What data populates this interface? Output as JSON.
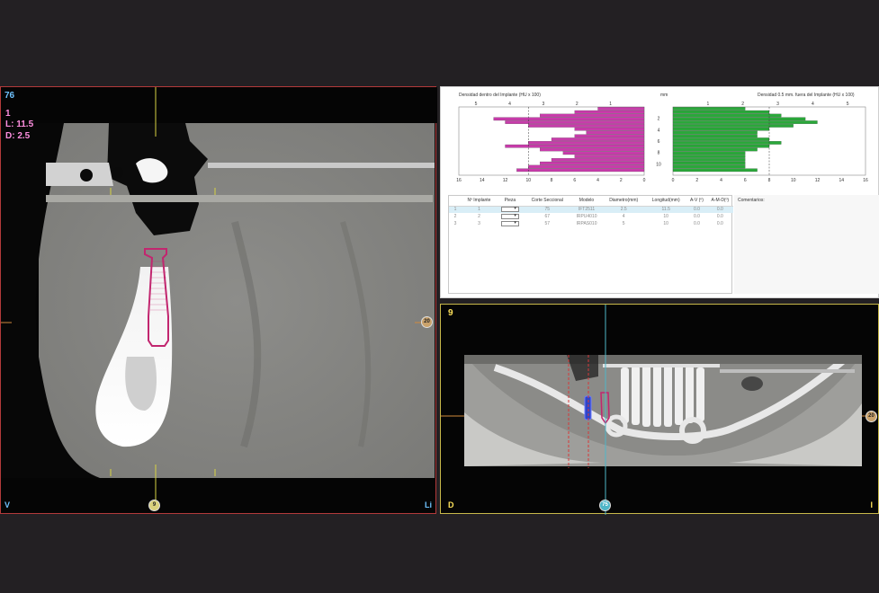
{
  "sagittal_view": {
    "slice_number": "76",
    "implant_number": "1",
    "implant_length": "L: 11.5",
    "implant_diameter": "D: 2.5",
    "orient_left": "V",
    "orient_right": "Li",
    "marker_right": "20",
    "marker_bottom": "9"
  },
  "density_panel": {
    "left_chart_title": "Densidad dentro del Implante (HU x 100)",
    "center_axis_label": "mm",
    "right_chart_title": "Densidad 0.5 mm. fuera del Implante (HU x 100)"
  },
  "chart_data": [
    {
      "type": "bar",
      "orientation": "horizontal",
      "title": "Densidad dentro del Implante (HU x 100)",
      "x_axis_direction": "reversed",
      "xlim": [
        0,
        16
      ],
      "x_bottom_ticks": [
        "16",
        "14",
        "12",
        "10",
        "8",
        "6",
        "4",
        "2",
        "0"
      ],
      "x_top_ticks": [
        "1",
        "2",
        "3",
        "4",
        "5"
      ],
      "ylabel": "mm",
      "ylim": [
        0,
        12
      ],
      "y_ticks": [
        "2",
        "4",
        "6",
        "8",
        "10"
      ],
      "y": [
        0.3,
        0.9,
        1.5,
        2.1,
        2.7,
        3.3,
        3.9,
        4.5,
        5.1,
        5.7,
        6.3,
        6.9,
        7.5,
        8.1,
        8.7,
        9.3,
        9.9,
        10.5,
        11.1
      ],
      "values": [
        4,
        6,
        9,
        13,
        12,
        10,
        6,
        5,
        6,
        8,
        10,
        12,
        9,
        7,
        6,
        8,
        9,
        10,
        11
      ],
      "color": "#c83cab"
    },
    {
      "type": "bar",
      "orientation": "horizontal",
      "title": "Densidad 0.5 mm. fuera del Implante (HU x 100)",
      "xlim": [
        0,
        16
      ],
      "x_bottom_ticks": [
        "0",
        "2",
        "4",
        "6",
        "8",
        "10",
        "12",
        "14",
        "16"
      ],
      "x_top_ticks": [
        "1",
        "2",
        "3",
        "4",
        "5"
      ],
      "ylim": [
        0,
        12
      ],
      "y_ticks": [
        "2",
        "4",
        "6",
        "8",
        "10"
      ],
      "y": [
        0.3,
        0.9,
        1.5,
        2.1,
        2.7,
        3.3,
        3.9,
        4.5,
        5.1,
        5.7,
        6.3,
        6.9,
        7.5,
        8.1,
        8.7,
        9.3,
        9.9,
        10.5,
        11.1
      ],
      "values": [
        6,
        8,
        9,
        11,
        12,
        10,
        8,
        7,
        7,
        8,
        9,
        8,
        7,
        6,
        6,
        6,
        6,
        6,
        7
      ],
      "color": "#2aa83a"
    }
  ],
  "implant_table": {
    "headers": [
      "Nº Implante",
      "Pieza",
      "Corte Seccional",
      "Modelo",
      "Diametro(mm)",
      "Longitud(mm)",
      "A-V (º)",
      "A-M-D(º)"
    ],
    "rows": [
      {
        "row_index": "1",
        "number": "1",
        "section": "75",
        "model": "IFT2511",
        "diameter": "2.5",
        "length": "11.5",
        "av": "0.0",
        "amd": "0.0"
      },
      {
        "row_index": "2",
        "number": "2",
        "section": "67",
        "model": "IRPU4010",
        "diameter": "4",
        "length": "10",
        "av": "0.0",
        "amd": "0.0"
      },
      {
        "row_index": "3",
        "number": "3",
        "section": "57",
        "model": "IRPAS010",
        "diameter": "5",
        "length": "10",
        "av": "0.0",
        "amd": "0.0"
      }
    ],
    "select_arrow": "▾"
  },
  "comments": {
    "label": "Comentarios:"
  },
  "panoramic_view": {
    "slice_number": "9",
    "orient_left": "D",
    "orient_right": "I",
    "marker_right": "20",
    "marker_bottom": "75"
  },
  "colors": {
    "sagittal_border": "#b33a3a",
    "panoramic_border": "#c9b94a",
    "left_bars": "#c83cab",
    "right_bars": "#2aa83a",
    "implant_outline": "#c2266f",
    "selected_row": "#d9eef7"
  }
}
